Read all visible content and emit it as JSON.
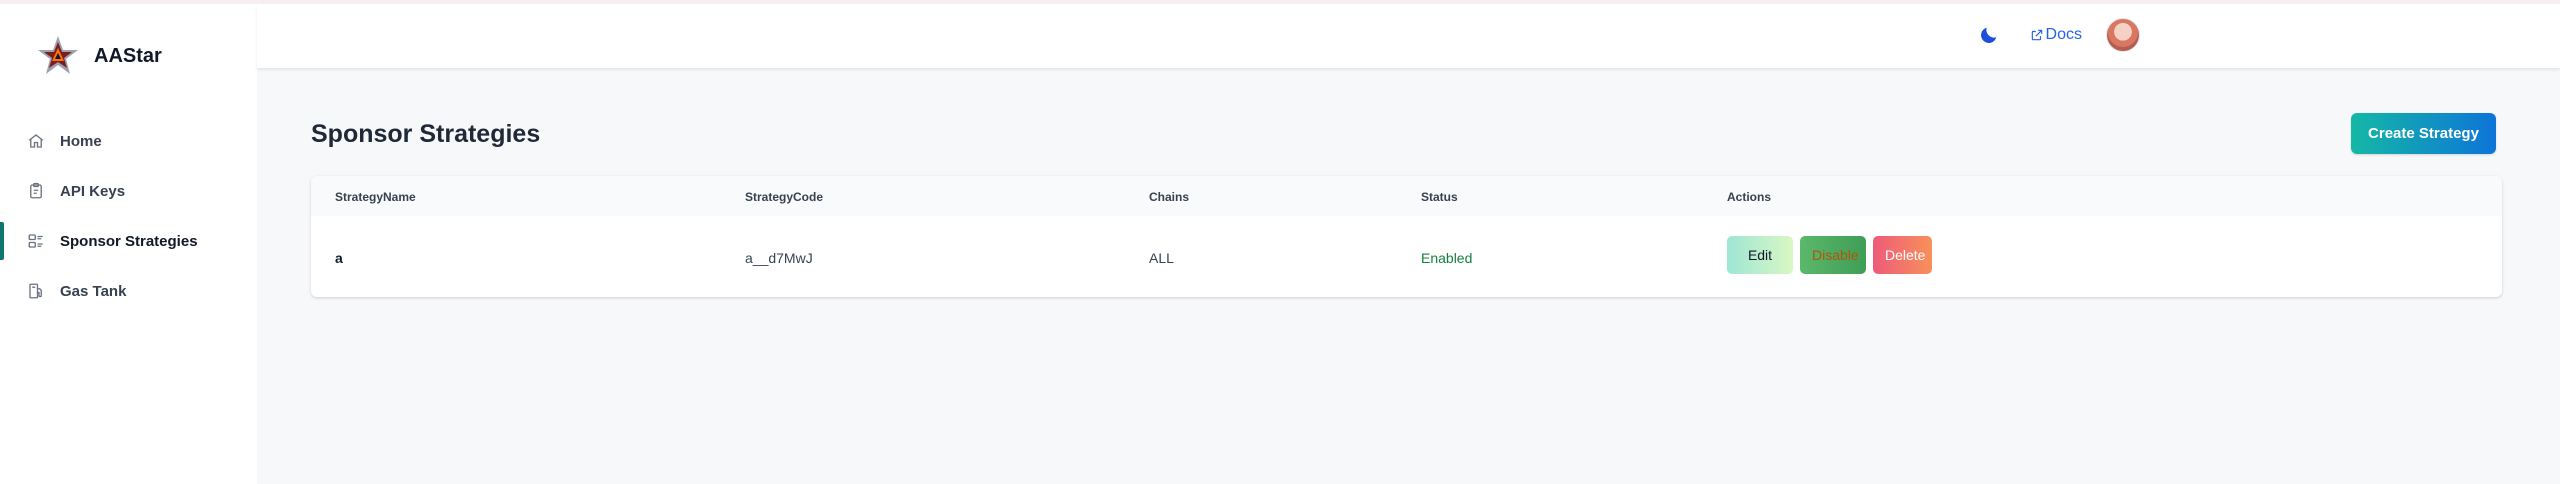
{
  "app": {
    "name": "AAStar"
  },
  "sidebar": {
    "items": [
      {
        "label": "Home",
        "icon": "home-icon",
        "active": false
      },
      {
        "label": "API Keys",
        "icon": "clipboard-icon",
        "active": false
      },
      {
        "label": "Sponsor Strategies",
        "icon": "layout-icon",
        "active": true
      },
      {
        "label": "Gas Tank",
        "icon": "fuel-icon",
        "active": false
      }
    ]
  },
  "header": {
    "docs_label": "Docs",
    "theme_icon": "moon-icon",
    "avatar_icon": "avatar"
  },
  "main": {
    "title": "Sponsor Strategies",
    "create_label": "Create Strategy",
    "table": {
      "columns": [
        "StrategyName",
        "StrategyCode",
        "Chains",
        "Status",
        "Actions"
      ],
      "rows": [
        {
          "name": "a",
          "code": "a__d7MwJ",
          "chains": "ALL",
          "status": "Enabled",
          "actions": {
            "edit": "Edit",
            "disable": "Disable",
            "delete": "Delete"
          }
        }
      ]
    }
  },
  "colors": {
    "accent": "#0f766e",
    "link": "#2563eb",
    "status_enabled": "#15803d"
  }
}
